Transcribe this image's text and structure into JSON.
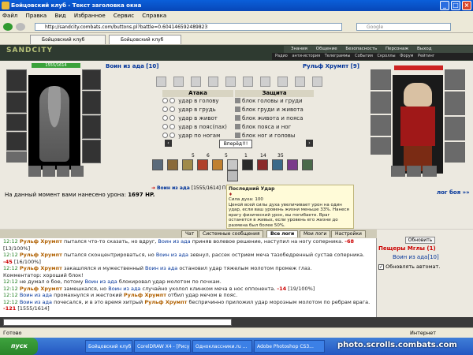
{
  "window": {
    "title": "Бойцовский клуб - Текст заголовка окна"
  },
  "menu": [
    "Файл",
    "Правка",
    "Вид",
    "Избранное",
    "Сервис",
    "Справка"
  ],
  "address": {
    "url": "http://sandcity.combats.com/buttons.pl?battle=0.604146592489823",
    "search_placeholder": "Google"
  },
  "tabs": [
    "Бойцовский клуб",
    "Бойцовский клуб"
  ],
  "game": {
    "logo": "SANDCITY",
    "topnav": [
      "Знания",
      "Общение",
      "Безопасность",
      "Персонаж",
      "Выход"
    ],
    "subnav": [
      "Радио",
      "анти-история",
      "Телеграммы",
      "События",
      "Скроллы",
      "Форум",
      "Рейтинг"
    ],
    "left_player": {
      "name": "Воин из ада",
      "level": "[10]",
      "hp": "1555/1614"
    },
    "right_player": {
      "name": "Рульф Хрумпт",
      "level": "[9]"
    },
    "attack": {
      "title": "Атака",
      "rows": [
        "удар в голову",
        "удар в грудь",
        "удар в живот",
        "удар в пояс(пах)",
        "удар по ногам"
      ]
    },
    "defense": {
      "title": "Защита",
      "rows": [
        "блок головы и груди",
        "блок груди и живота",
        "блок живота и пояса",
        "блок пояса и ног",
        "блок ног и головы"
      ]
    },
    "forward_button": "Вперёд!!!",
    "effect_counts": [
      "5",
      "6",
      "5",
      "1",
      "14",
      "35"
    ],
    "damage_text": "На данный момент вами нанесено урона:",
    "damage_value": "1697 HP.",
    "battle_line_name": "Воин из ада",
    "battle_line_hp": "[1555/1614]",
    "battle_line_tail": "П",
    "battlelog_link": "лог боя »»",
    "tooltip": {
      "title": "Последний Удар",
      "line1": "Сила духа: 100",
      "body": "Ценой всей силы духа увеличивает урон на один удар, если ваш уровень жизни меньше 33%. Нанеся врагу физический урон, вы погибаете. Враг останется в живых, если уровень его жизни до размена был более 50%."
    }
  },
  "chat_tabs": [
    "Чат",
    "Системные сообщения",
    "Все логи",
    "Мои логи",
    "Настройки"
  ],
  "chat": [
    {
      "time": "12:12",
      "a": "Рульф Хрумпт",
      "text": "пытался что-то сказать, но вдруг,",
      "b": "Воин из ада",
      "text2": "приняв волевое решение, наступил на ногу соперника.",
      "dmg": "-68",
      "tail": "[13/100%]"
    },
    {
      "time": "12:12",
      "a": "Рульф Хрумпт",
      "text": "пытался сконцентрироваться, но",
      "b": "Воин из ада",
      "text2": "зевнул, рассек острием меча тазобедренный сустав соперника.",
      "dmg": "-45",
      "tail": "[16/100%]"
    },
    {
      "time": "12:12",
      "a": "Рульф Хрумпт",
      "text": "закашлялся и мужественный",
      "b": "Воин из ада",
      "text2": "остановил удар тяжелым молотом промеж глаз.",
      "dmg": "",
      "tail": ""
    },
    {
      "comment": "Комментатор: хороший блок!"
    },
    {
      "time": "12:12",
      "a": "",
      "text": "не думал о бое, потому",
      "b": "Воин из ада",
      "text2": "блокировал удар молотом по почкам.",
      "dmg": "",
      "tail": ""
    },
    {
      "time": "12:12",
      "a": "Рульф Хрумпт",
      "text": "замешкался, но",
      "b": "Воин из ада",
      "text2": "случайно уколол клинком меча в нос оппонента.",
      "dmg": "-14",
      "tail": "[19/100%]"
    },
    {
      "time": "12:12",
      "a": "Воин из ада",
      "text": "промахнулся и жестокий",
      "b": "Рульф Хрумпт",
      "text2": "отбил удар мечом в пояс.",
      "dmg": "",
      "tail": ""
    },
    {
      "time": "12:12",
      "a": "Воин из ада",
      "text": "почесался, и в это время хитрый",
      "b": "Рульф Хрумпт",
      "text2": "беспричинно приложил удар морозным молотом по ребрам врага.",
      "dmg": "-121",
      "tail": "[1555/1614]"
    }
  ],
  "right_panel": {
    "refresh": "Обновить",
    "cave": "Пещеры Мглы (1)",
    "user": "Воин из ада",
    "user_level": "[10]",
    "auto": "Обновлять автомат."
  },
  "status": {
    "left": "Готово",
    "right": "Интернет"
  },
  "taskbar": {
    "start": "пуск",
    "items": [
      "Бойцовский клуб - Те...",
      "CorelDRAW X4 - [Рису...",
      "Одноклассники.ru ...",
      "Adobe Photoshop CS3..."
    ]
  },
  "watermark": "photo.scrolls.combats.com"
}
